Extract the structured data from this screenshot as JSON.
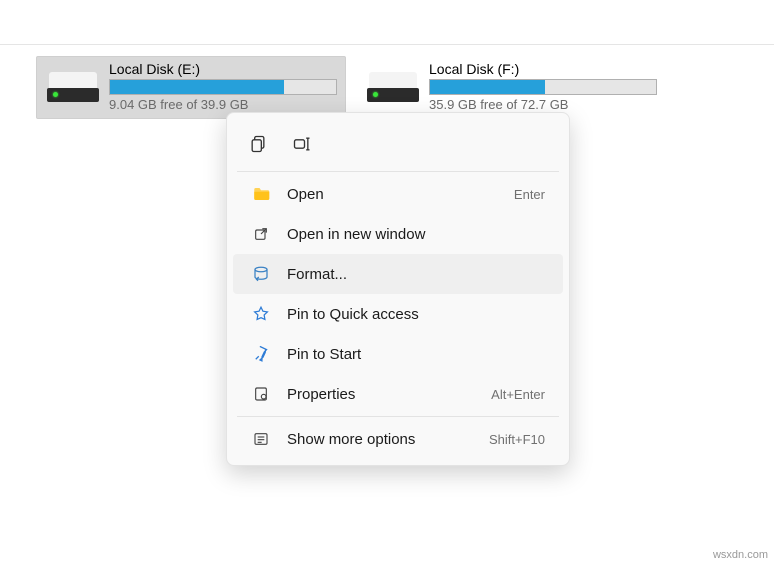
{
  "drives": [
    {
      "label": "Local Disk (E:)",
      "space_text": "9.04 GB free of 39.9 GB",
      "used_percent": 77,
      "selected": true
    },
    {
      "label": "Local Disk (F:)",
      "space_text": "35.9 GB free of 72.7 GB",
      "used_percent": 51,
      "selected": false
    }
  ],
  "context_menu": {
    "items": [
      {
        "icon": "folder",
        "label": "Open",
        "shortcut": "Enter"
      },
      {
        "icon": "open-external",
        "label": "Open in new window",
        "shortcut": ""
      },
      {
        "icon": "format",
        "label": "Format...",
        "shortcut": "",
        "hover": true
      },
      {
        "icon": "star",
        "label": "Pin to Quick access",
        "shortcut": ""
      },
      {
        "icon": "pin",
        "label": "Pin to Start",
        "shortcut": ""
      },
      {
        "icon": "properties",
        "label": "Properties",
        "shortcut": "Alt+Enter"
      }
    ],
    "more": {
      "icon": "more",
      "label": "Show more options",
      "shortcut": "Shift+F10"
    }
  },
  "watermark": "wsxdn.com"
}
